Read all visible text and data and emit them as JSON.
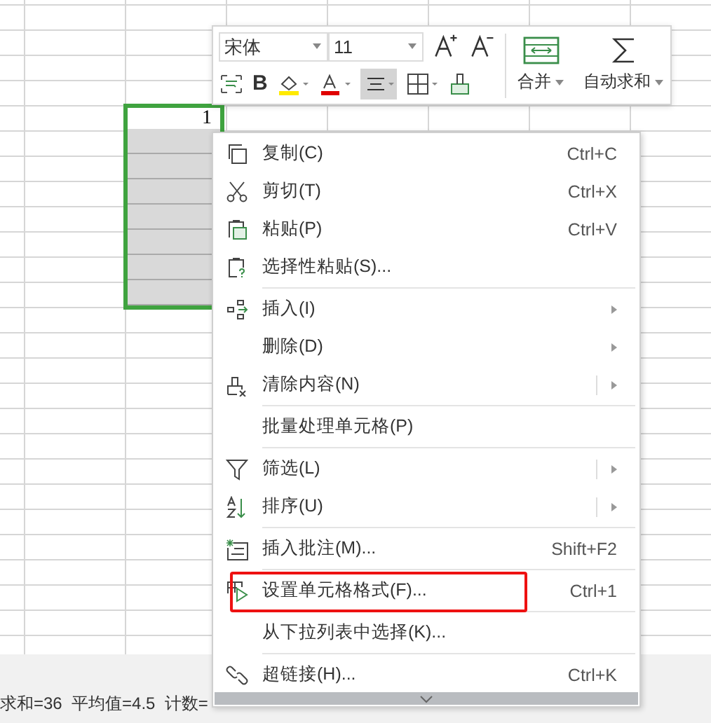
{
  "sheet": {
    "selection": {
      "first_value": "1"
    }
  },
  "toolbar": {
    "bold_label": "B",
    "font": "宋体",
    "size": "11",
    "align_button": {
      "selected": true
    },
    "merge_label": "合并",
    "sum_label": "自动求和"
  },
  "menu": {
    "groups": [
      [
        {
          "label": "复制(C)",
          "shortcut": "Ctrl+C",
          "submenu": false,
          "split": false,
          "highlighted": false
        },
        {
          "label": "剪切(T)",
          "shortcut": "Ctrl+X",
          "submenu": false,
          "split": false,
          "highlighted": false
        },
        {
          "label": "粘贴(P)",
          "shortcut": "Ctrl+V",
          "submenu": false,
          "split": false,
          "highlighted": false
        },
        {
          "label": "选择性粘贴(S)...",
          "submenu": false,
          "split": false,
          "highlighted": false
        }
      ],
      [
        {
          "label": "插入(I)",
          "submenu": true,
          "split": false,
          "highlighted": false
        },
        {
          "label": "删除(D)",
          "submenu": true,
          "split": false,
          "highlighted": false
        },
        {
          "label": "清除内容(N)",
          "submenu": true,
          "split": true,
          "highlighted": false
        }
      ],
      [
        {
          "label": "批量处理单元格(P)",
          "submenu": false,
          "split": false,
          "highlighted": false
        }
      ],
      [
        {
          "label": "筛选(L)",
          "submenu": true,
          "split": true,
          "highlighted": false
        },
        {
          "label": "排序(U)",
          "submenu": true,
          "split": true,
          "highlighted": false
        }
      ],
      [
        {
          "label": "插入批注(M)...",
          "shortcut": "Shift+F2",
          "submenu": false,
          "split": false,
          "highlighted": false
        }
      ],
      [
        {
          "label": "设置单元格格式(F)...",
          "shortcut": "Ctrl+1",
          "submenu": false,
          "split": false,
          "highlighted": true
        }
      ],
      [
        {
          "label": "从下拉列表中选择(K)...",
          "submenu": false,
          "split": false,
          "highlighted": false
        }
      ],
      [
        {
          "label": "超链接(H)...",
          "shortcut": "Ctrl+K",
          "submenu": false,
          "split": false,
          "highlighted": false
        }
      ]
    ]
  },
  "status_bar": {
    "text": "求和=36  平均值=4.5  计数="
  }
}
